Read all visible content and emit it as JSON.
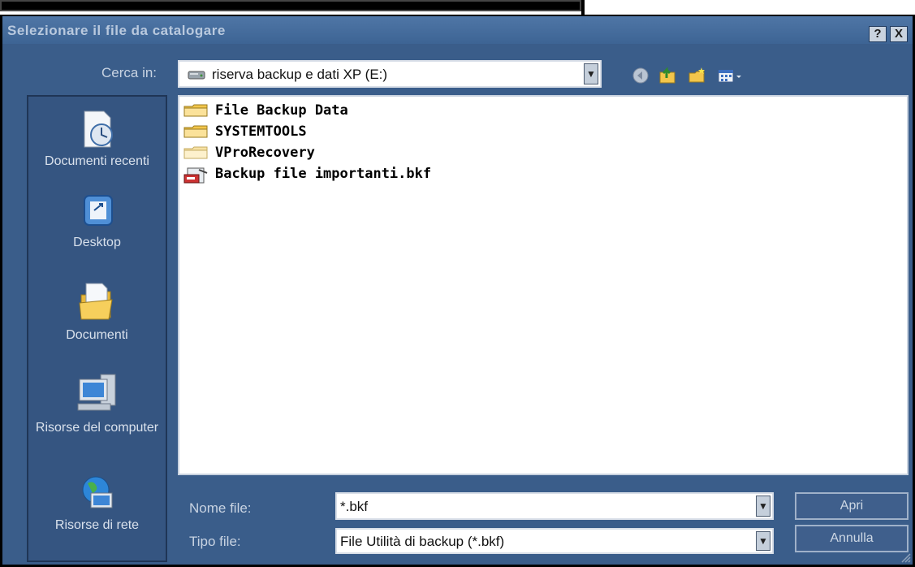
{
  "dialog": {
    "title": "Selezionare il file da catalogare",
    "help_label": "?",
    "close_label": "X"
  },
  "lookin": {
    "label": "Cerca in:",
    "value": "riserva backup e dati XP (E:)"
  },
  "places": [
    {
      "label": "Documenti recenti",
      "icon": "recent-documents-icon"
    },
    {
      "label": "Desktop",
      "icon": "desktop-icon"
    },
    {
      "label": "Documenti",
      "icon": "documents-folder-icon"
    },
    {
      "label": "Risorse del computer",
      "icon": "my-computer-icon"
    },
    {
      "label": "Risorse di rete",
      "icon": "network-icon"
    }
  ],
  "files": [
    {
      "name": "File Backup Data",
      "type": "folder"
    },
    {
      "name": "SYSTEMTOOLS",
      "type": "folder"
    },
    {
      "name": "VProRecovery",
      "type": "folder"
    },
    {
      "name": "Backup file importanti.bkf",
      "type": "bkf"
    }
  ],
  "filename": {
    "label": "Nome file:",
    "value": "*.bkf"
  },
  "filetype": {
    "label": "Tipo file:",
    "value": "File Utilità di backup (*.bkf)"
  },
  "buttons": {
    "open": "Apri",
    "cancel": "Annulla"
  },
  "colors": {
    "dialog_bg": "#3a5d8a",
    "places_bg": "#355581",
    "folder": "#f3c64b"
  }
}
